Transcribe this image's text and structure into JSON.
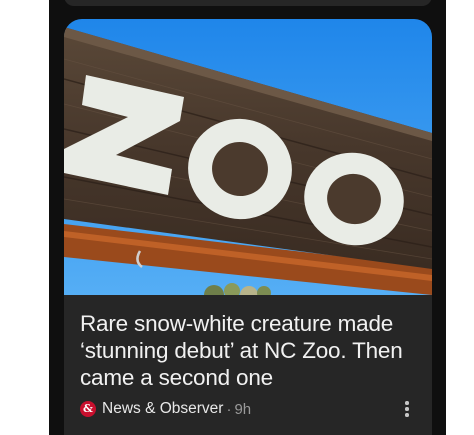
{
  "card": {
    "image_sign_text": "ZOO",
    "headline": "Rare snow-white creature made ‘stunning debut’ at NC Zoo. Then came a second one",
    "source": {
      "favicon_glyph": "&",
      "favicon_color": "#c8102e",
      "name": "News & Observer",
      "separator": "·",
      "time": "9h"
    },
    "more_icon": "more-vertical-icon"
  },
  "colors": {
    "feed_background": "#0f0f0f",
    "card_background": "#262626",
    "sky": "#2f8ee8",
    "sign_wood": "#4a3a2e",
    "letter": "#e9ece6"
  }
}
